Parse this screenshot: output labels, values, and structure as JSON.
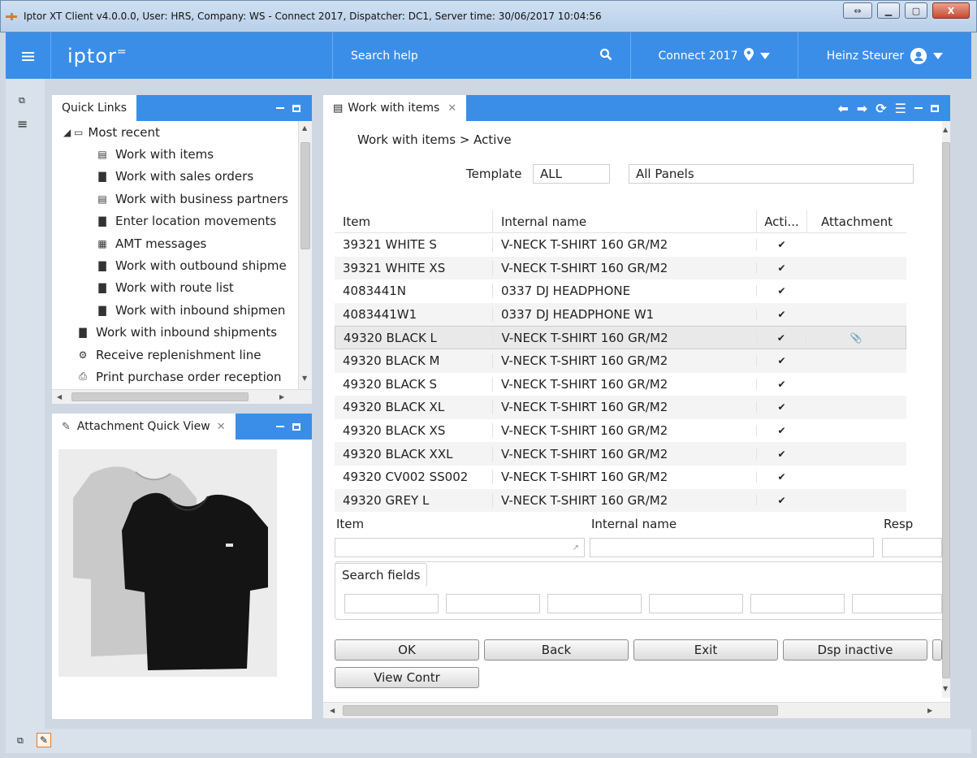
{
  "window": {
    "title": "Iptor XT Client v4.0.0.0, User: HRS, Company: WS - Connect 2017, Dispatcher: DC1, Server time: 30/06/2017 10:04:56",
    "restore_glyph": "⇔",
    "minimize_glyph": "▁",
    "maximize_glyph": "▢",
    "close_glyph": "X"
  },
  "topbar": {
    "menu_glyph": "≡",
    "logo": "iptor",
    "logo_mark": "=",
    "search_placeholder": "Search help",
    "search_glyph": "🔍",
    "connection": "Connect 2017",
    "user": "Heinz Steurer",
    "accent": "#3b8ee8"
  },
  "quick_links": {
    "title": "Quick Links",
    "items": [
      {
        "label": "Most recent",
        "icon": "folder-icon",
        "glyph": "◢ ▭"
      },
      {
        "label": "Work with items",
        "icon": "list-icon",
        "glyph": "▤"
      },
      {
        "label": "Work with sales orders",
        "icon": "document-icon",
        "glyph": "▇"
      },
      {
        "label": "Work with business partners",
        "icon": "list-icon",
        "glyph": "▤"
      },
      {
        "label": "Enter location movements",
        "icon": "document-icon",
        "glyph": "▇"
      },
      {
        "label": "AMT messages",
        "icon": "table-icon",
        "glyph": "▦"
      },
      {
        "label": "Work with outbound shipme",
        "icon": "document-icon",
        "glyph": "▇"
      },
      {
        "label": "Work with route list",
        "icon": "document-icon",
        "glyph": "▇"
      },
      {
        "label": "Work with inbound shipmen",
        "icon": "document-icon",
        "glyph": "▇"
      },
      {
        "label": "Work with inbound shipments",
        "icon": "document-icon",
        "glyph": "▇"
      },
      {
        "label": "Receive replenishment line",
        "icon": "gear-icon",
        "glyph": "⚙"
      },
      {
        "label": "Print purchase order reception",
        "icon": "printer-icon",
        "glyph": "⎙"
      }
    ]
  },
  "attachment_view": {
    "title": "Attachment Quick View"
  },
  "work_items": {
    "tab_title": "Work with items",
    "breadcrumb": "Work with items > Active",
    "template_label": "Template",
    "template_value": "ALL",
    "panels_value": "All Panels",
    "columns": [
      "Item",
      "Internal name",
      "Acti...",
      "Attachment"
    ],
    "rows": [
      {
        "item": "39321 WHITE S",
        "name": "V-NECK T-SHIRT 160 GR/M2",
        "active": "✔",
        "attachment": ""
      },
      {
        "item": "39321 WHITE XS",
        "name": "V-NECK T-SHIRT 160 GR/M2",
        "active": "✔",
        "attachment": ""
      },
      {
        "item": "4083441N",
        "name": "0337 DJ HEADPHONE",
        "active": "✔",
        "attachment": ""
      },
      {
        "item": "4083441W1",
        "name": "0337 DJ HEADPHONE W1",
        "active": "✔",
        "attachment": ""
      },
      {
        "item": "49320 BLACK L",
        "name": "V-NECK T-SHIRT 160 GR/M2",
        "active": "✔",
        "attachment": "📎"
      },
      {
        "item": "49320 BLACK M",
        "name": "V-NECK T-SHIRT 160 GR/M2",
        "active": "✔",
        "attachment": ""
      },
      {
        "item": "49320 BLACK S",
        "name": "V-NECK T-SHIRT 160 GR/M2",
        "active": "✔",
        "attachment": ""
      },
      {
        "item": "49320 BLACK XL",
        "name": "V-NECK T-SHIRT 160 GR/M2",
        "active": "✔",
        "attachment": ""
      },
      {
        "item": "49320 BLACK XS",
        "name": "V-NECK T-SHIRT 160 GR/M2",
        "active": "✔",
        "attachment": ""
      },
      {
        "item": "49320 BLACK XXL",
        "name": "V-NECK T-SHIRT 160 GR/M2",
        "active": "✔",
        "attachment": ""
      },
      {
        "item": "49320 CV002 SS002",
        "name": "V-NECK T-SHIRT 160 GR/M2",
        "active": "✔",
        "attachment": ""
      },
      {
        "item": "49320 GREY L",
        "name": "V-NECK T-SHIRT 160 GR/M2",
        "active": "✔",
        "attachment": ""
      }
    ],
    "filter_item_label": "Item",
    "filter_name_label": "Internal name",
    "filter_resp_label": "Resp",
    "search_fields_label": "Search fields",
    "buttons": {
      "ok": "OK",
      "back": "Back",
      "exit": "Exit",
      "dsp_inactive": "Dsp inactive",
      "view_contr": "View Contr"
    }
  }
}
